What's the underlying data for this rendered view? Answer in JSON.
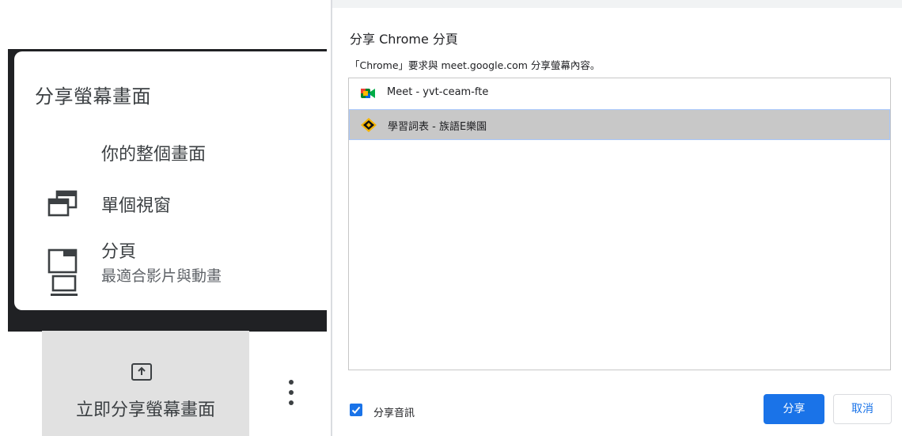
{
  "meet_menu": {
    "title": "分享螢幕畫面",
    "items": [
      {
        "label": "你的整個畫面",
        "icon": "laptop-icon"
      },
      {
        "label": "單個視窗",
        "icon": "window-icon"
      },
      {
        "label": "分頁",
        "sublabel": "最適合影片與動畫",
        "icon": "tab-icon"
      }
    ],
    "share_now_label": "立即分享螢幕畫面",
    "more_icon": "more-vert-icon"
  },
  "chrome_dialog": {
    "title": "分享 Chrome 分頁",
    "description": "「Chrome」要求與 meet.google.com 分享螢幕內容。",
    "tabs": [
      {
        "label": "Meet - yvt-ceam-fte",
        "icon": "google-meet-icon",
        "selected": false
      },
      {
        "label": "學習詞表 - 族語E樂園",
        "icon": "site-favicon-icon",
        "selected": true
      }
    ],
    "share_audio_label": "分享音訊",
    "share_audio_checked": true,
    "share_button": "分享",
    "cancel_button": "取消"
  },
  "colors": {
    "accent": "#1a73e8",
    "selected_row": "#c8c8c8",
    "dark_backdrop": "#202124"
  }
}
